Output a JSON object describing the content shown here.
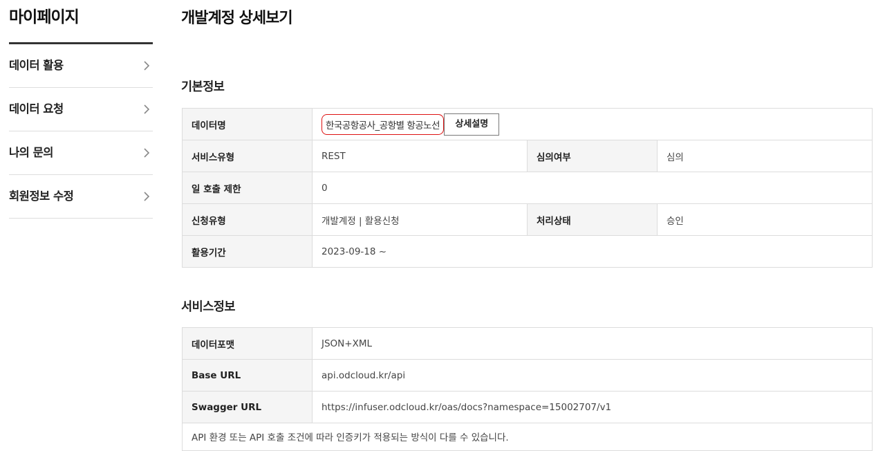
{
  "sidebar": {
    "title": "마이페이지",
    "items": [
      {
        "label": "데이터 활용"
      },
      {
        "label": "데이터 요청"
      },
      {
        "label": "나의 문의"
      },
      {
        "label": "회원정보 수정"
      }
    ]
  },
  "main": {
    "title": "개발계정 상세보기",
    "basic_info": {
      "title": "기본정보",
      "data_name_label": "데이터명",
      "data_name_value": "한국공항공사_공항별 항공노선",
      "detail_button": "상세설명",
      "service_type_label": "서비스유형",
      "service_type_value": "REST",
      "review_label": "심의여부",
      "review_value": "심의",
      "daily_limit_label": "일 호출 제한",
      "daily_limit_value": "0",
      "apply_type_label": "신청유형",
      "apply_type_value": "개발계정 | 활용신청",
      "status_label": "처리상태",
      "status_value": "승인",
      "period_label": "활용기간",
      "period_value": "2023-09-18 ~"
    },
    "service_info": {
      "title": "서비스정보",
      "format_label": "데이터포맷",
      "format_value": "JSON+XML",
      "base_url_label": "Base URL",
      "base_url_value": "api.odcloud.kr/api",
      "swagger_label": "Swagger URL",
      "swagger_value": "https://infuser.odcloud.kr/oas/docs?namespace=15002707/v1",
      "note_cut": "API 환경 또는 API 호출 조건에 따라 인증키가 적용되는 방식이 다를 수 있습니다."
    }
  }
}
